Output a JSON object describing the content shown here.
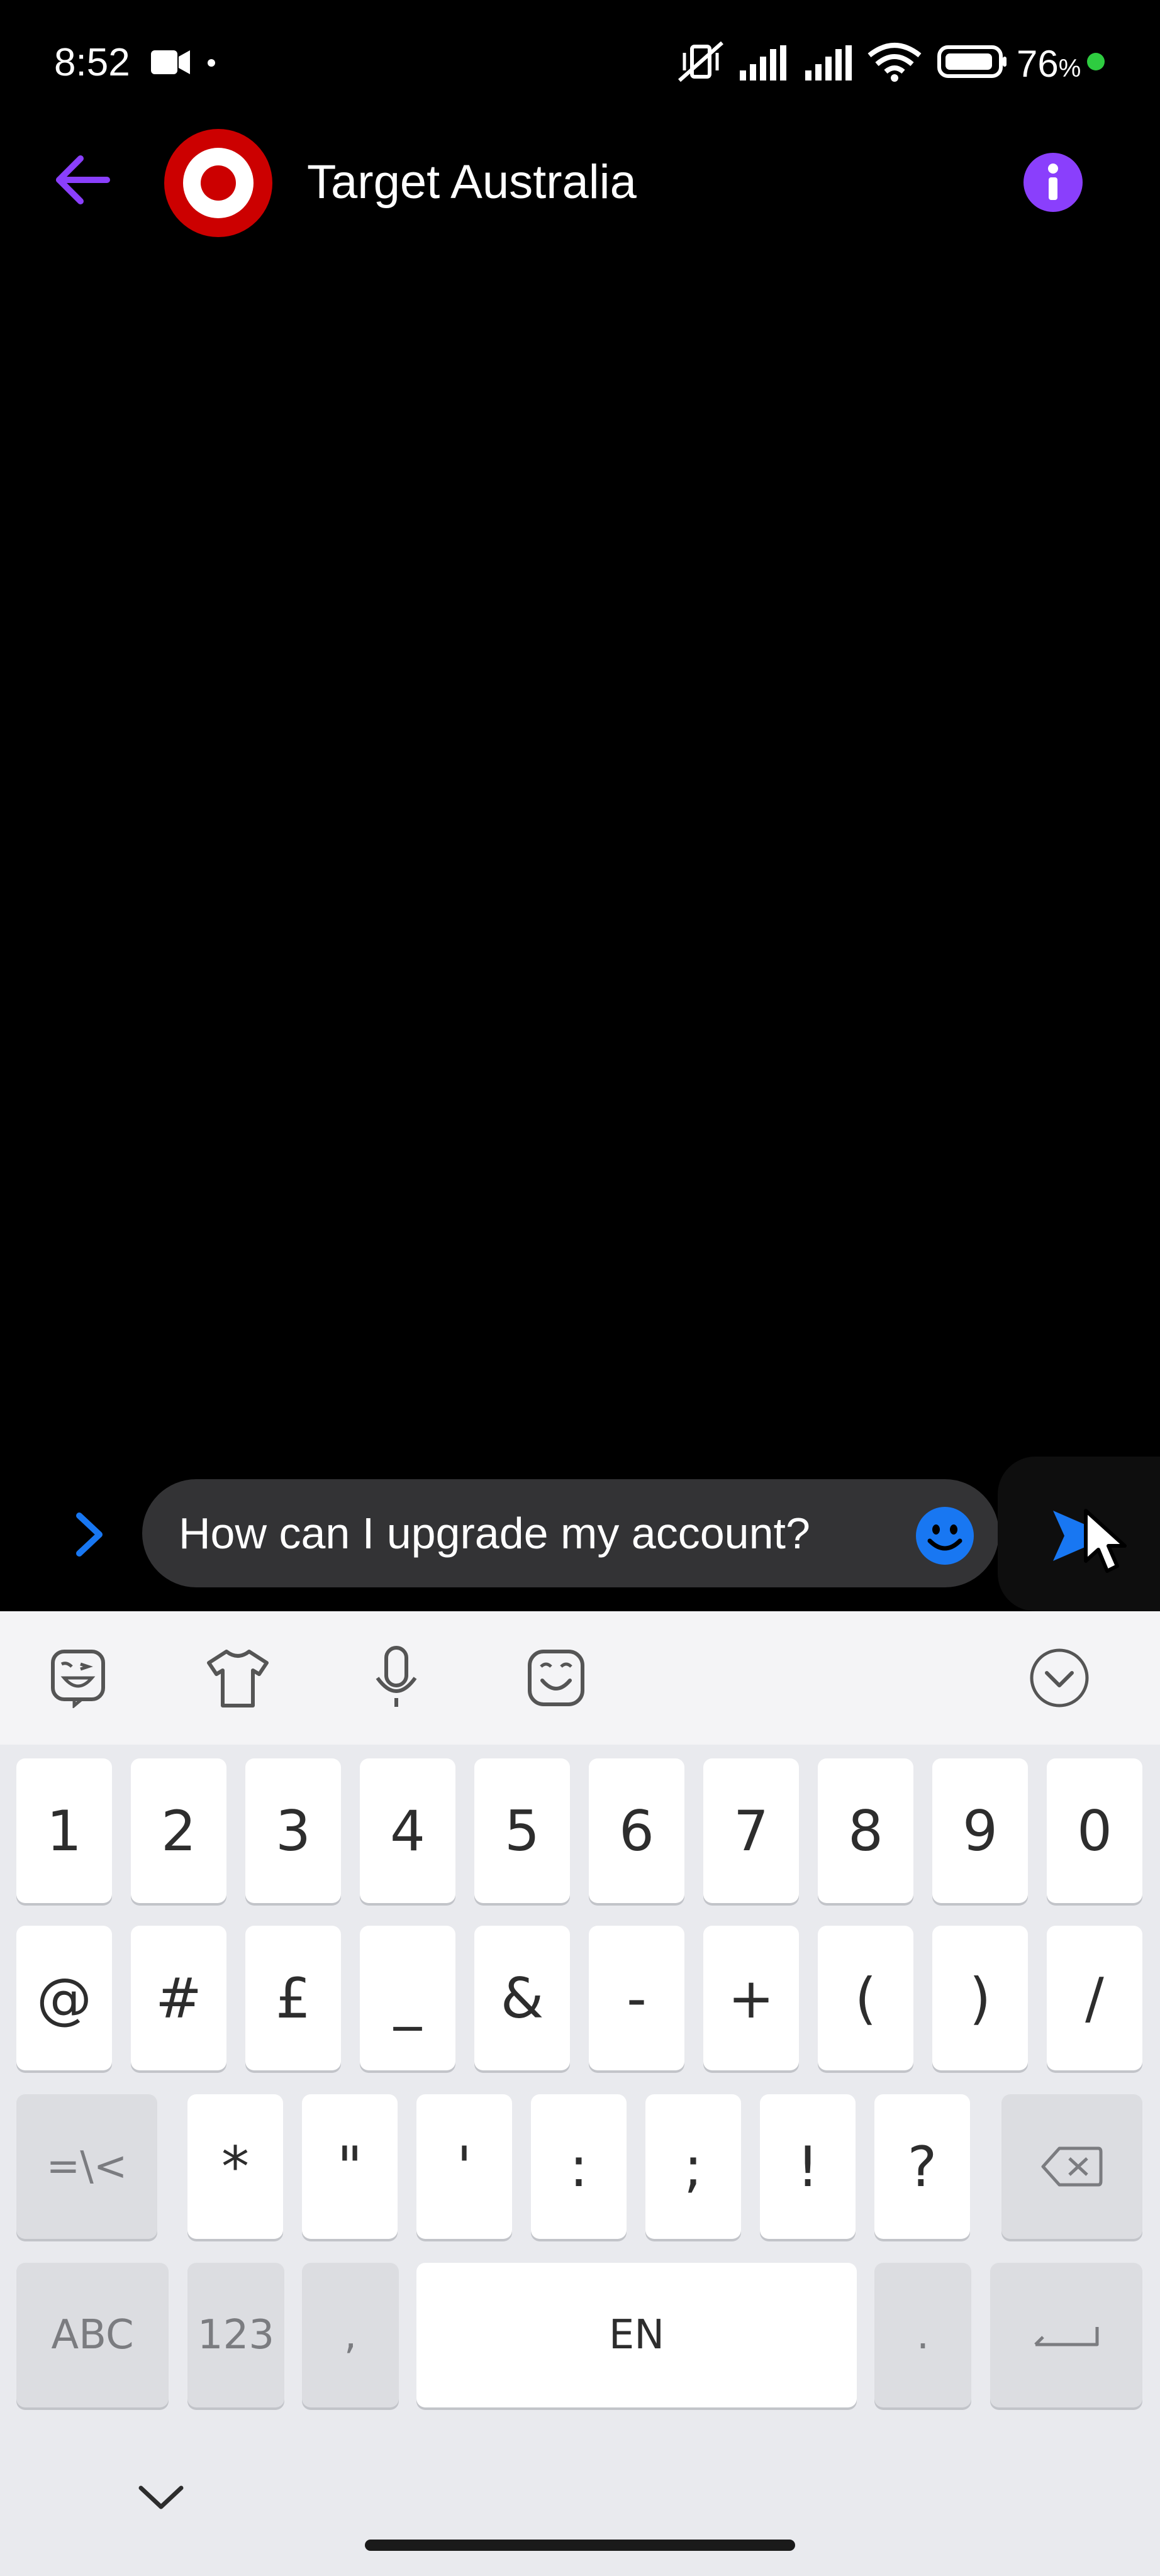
{
  "status_bar": {
    "time": "8:52",
    "battery": "76",
    "battery_unit": "%"
  },
  "header": {
    "title": "Target Australia"
  },
  "composer": {
    "text": "How can I upgrade my account?"
  },
  "keyboard": {
    "row1": [
      "1",
      "2",
      "3",
      "4",
      "5",
      "6",
      "7",
      "8",
      "9",
      "0"
    ],
    "row2": [
      "@",
      "#",
      "£",
      "_",
      "&",
      "-",
      "+",
      "(",
      ")",
      "/"
    ],
    "row3": [
      "*",
      "\"",
      "'",
      ":",
      ";",
      "!",
      "?"
    ],
    "row3_left": "=\\<",
    "row4_abc": "ABC",
    "row4_123": "123",
    "row4_comma": ",",
    "row4_space": "EN",
    "row4_period": "."
  },
  "colors": {
    "accent_purple": "#8a3ffc",
    "blue": "#1877f2",
    "target_red": "#cc0000"
  }
}
